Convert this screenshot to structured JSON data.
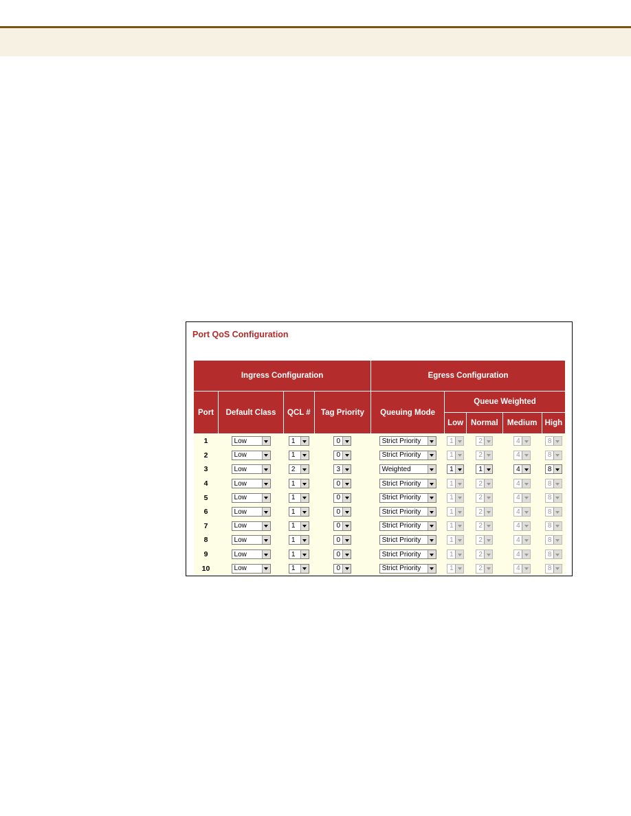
{
  "panel": {
    "title": "Port QoS Configuration",
    "headers": {
      "ingress": "Ingress Configuration",
      "egress": "Egress Configuration",
      "port": "Port",
      "default_class": "Default Class",
      "qcl": "QCL #",
      "tag_priority": "Tag Priority",
      "queuing_mode": "Queuing Mode",
      "queue_weighted": "Queue Weighted",
      "low": "Low",
      "normal": "Normal",
      "medium": "Medium",
      "high": "High"
    },
    "rows": [
      {
        "port": "1",
        "default_class": "Low",
        "qcl": "1",
        "tag_priority": "0",
        "queuing_mode": "Strict Priority",
        "low": "1",
        "normal": "2",
        "medium": "4",
        "high": "8",
        "weights_enabled": false
      },
      {
        "port": "2",
        "default_class": "Low",
        "qcl": "1",
        "tag_priority": "0",
        "queuing_mode": "Strict Priority",
        "low": "1",
        "normal": "2",
        "medium": "4",
        "high": "8",
        "weights_enabled": false
      },
      {
        "port": "3",
        "default_class": "Low",
        "qcl": "2",
        "tag_priority": "3",
        "queuing_mode": "Weighted",
        "low": "1",
        "normal": "1",
        "medium": "4",
        "high": "8",
        "weights_enabled": true
      },
      {
        "port": "4",
        "default_class": "Low",
        "qcl": "1",
        "tag_priority": "0",
        "queuing_mode": "Strict Priority",
        "low": "1",
        "normal": "2",
        "medium": "4",
        "high": "8",
        "weights_enabled": false
      },
      {
        "port": "5",
        "default_class": "Low",
        "qcl": "1",
        "tag_priority": "0",
        "queuing_mode": "Strict Priority",
        "low": "1",
        "normal": "2",
        "medium": "4",
        "high": "8",
        "weights_enabled": false
      },
      {
        "port": "6",
        "default_class": "Low",
        "qcl": "1",
        "tag_priority": "0",
        "queuing_mode": "Strict Priority",
        "low": "1",
        "normal": "2",
        "medium": "4",
        "high": "8",
        "weights_enabled": false
      },
      {
        "port": "7",
        "default_class": "Low",
        "qcl": "1",
        "tag_priority": "0",
        "queuing_mode": "Strict Priority",
        "low": "1",
        "normal": "2",
        "medium": "4",
        "high": "8",
        "weights_enabled": false
      },
      {
        "port": "8",
        "default_class": "Low",
        "qcl": "1",
        "tag_priority": "0",
        "queuing_mode": "Strict Priority",
        "low": "1",
        "normal": "2",
        "medium": "4",
        "high": "8",
        "weights_enabled": false
      },
      {
        "port": "9",
        "default_class": "Low",
        "qcl": "1",
        "tag_priority": "0",
        "queuing_mode": "Strict Priority",
        "low": "1",
        "normal": "2",
        "medium": "4",
        "high": "8",
        "weights_enabled": false
      },
      {
        "port": "10",
        "default_class": "Low",
        "qcl": "1",
        "tag_priority": "0",
        "queuing_mode": "Strict Priority",
        "low": "1",
        "normal": "2",
        "medium": "4",
        "high": "8",
        "weights_enabled": false
      }
    ]
  }
}
